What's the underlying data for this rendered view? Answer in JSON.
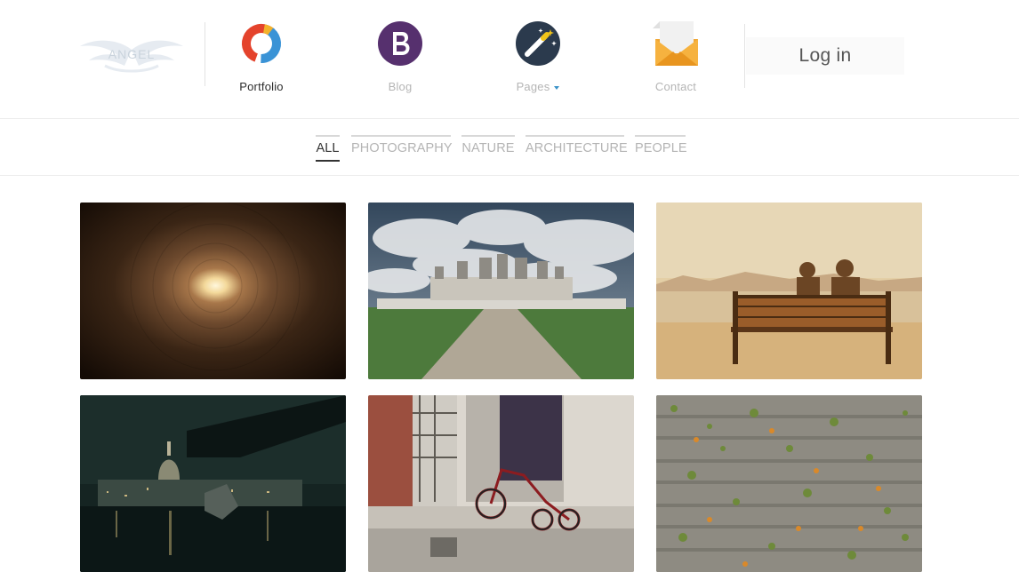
{
  "logo": {
    "text": "ANGEL"
  },
  "nav": {
    "items": [
      {
        "label": "Portfolio",
        "icon": "portfolio-ring-icon",
        "active": true
      },
      {
        "label": "Blog",
        "icon": "bootstrap-b-icon",
        "active": false
      },
      {
        "label": "Pages",
        "icon": "magic-wand-icon",
        "active": false,
        "dropdown": true
      },
      {
        "label": "Contact",
        "icon": "envelope-icon",
        "active": false
      }
    ],
    "login_label": "Log in"
  },
  "filters": {
    "items": [
      {
        "label": "ALL",
        "active": true
      },
      {
        "label": "PHOTOGRAPHY",
        "active": false
      },
      {
        "label": "NATURE",
        "active": false
      },
      {
        "label": "ARCHITECTURE",
        "active": false
      },
      {
        "label": "PEOPLE",
        "active": false
      }
    ]
  },
  "gallery": {
    "items": [
      {
        "subject": "tunnel-light"
      },
      {
        "subject": "chateau"
      },
      {
        "subject": "couple-on-bench"
      },
      {
        "subject": "city-night"
      },
      {
        "subject": "tricycle"
      },
      {
        "subject": "wooden-planks-leaves"
      }
    ]
  },
  "colors": {
    "accent": "#3a92c8",
    "bootstrap_purple": "#56306e",
    "wand_navy": "#2b3a4d",
    "envelope_orange": "#f0a532",
    "portfolio_red": "#e4432c",
    "portfolio_blue": "#3a93d6"
  }
}
